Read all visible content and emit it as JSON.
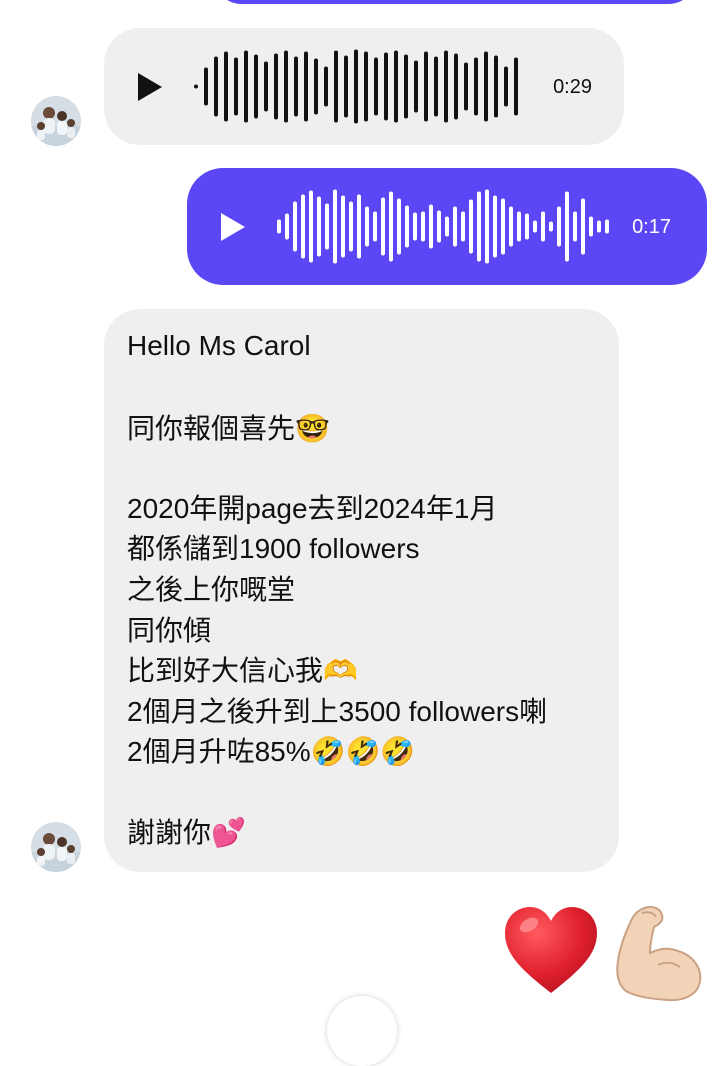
{
  "chat": {
    "voice_incoming": {
      "duration": "0:29",
      "play_icon": "play-icon"
    },
    "voice_outgoing": {
      "duration": "0:17",
      "play_icon": "play-icon"
    },
    "message": {
      "lines": [
        "Hello Ms Carol",
        "同你報個喜先🤓",
        "2020年開page去到2024年1月",
        "都係儲到1900 followers",
        "之後上你嘅堂",
        "同你傾",
        "比到好大信心我🫶",
        "2個月之後升到上3500 followers喇",
        "2個月升咗85%🤣🤣🤣",
        "謝謝你💕"
      ]
    },
    "reactions": [
      "heart-emoji",
      "flexed-biceps-emoji"
    ]
  },
  "colors": {
    "outgoing_bubble": "#5b47f6",
    "incoming_bubble": "#efefef",
    "heart": "#e0202e"
  }
}
